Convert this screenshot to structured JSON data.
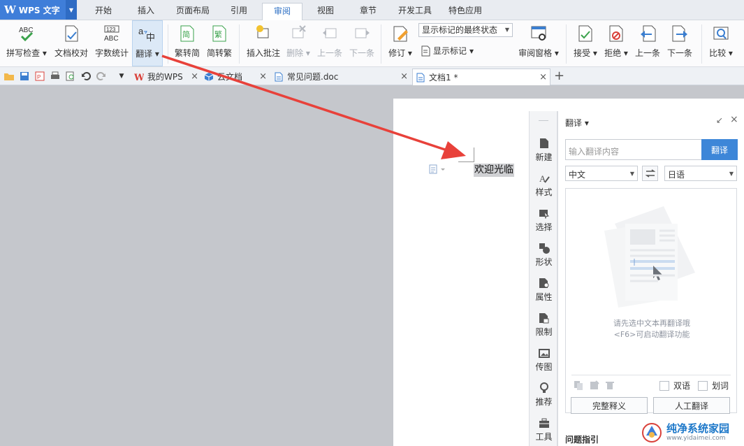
{
  "app": {
    "name": "WPS 文字"
  },
  "menu": {
    "tabs": [
      "开始",
      "插入",
      "页面布局",
      "引用",
      "审阅",
      "视图",
      "章节",
      "开发工具",
      "特色应用"
    ],
    "active_index": 4
  },
  "ribbon": {
    "spell_check": "拼写检查",
    "doc_proof": "文档校对",
    "word_count": "字数统计",
    "translate": "翻译",
    "trad_to_simp": "繁转简",
    "simp_to_trad": "简转繁",
    "insert_comment": "插入批注",
    "delete": "删除",
    "prev_comment": "上一条",
    "next_comment": "下一条",
    "track_changes": "修订",
    "markup_status": "显示标记的最终状态",
    "show_markup": "显示标记",
    "review_pane": "审阅窗格",
    "accept": "接受",
    "reject": "拒绝",
    "prev_change": "上一条",
    "next_change": "下一条",
    "compare": "比较"
  },
  "doc_tabs": [
    {
      "label": "我的WPS"
    },
    {
      "label": "云文档"
    },
    {
      "label": "常见问题.doc"
    },
    {
      "label": "文档1 *"
    }
  ],
  "document": {
    "text": "欢迎光临"
  },
  "sidebar": {
    "items": [
      "新建",
      "样式",
      "选择",
      "形状",
      "属性",
      "限制",
      "传图",
      "推荐",
      "工具"
    ]
  },
  "translate_panel": {
    "title": "翻译",
    "input_placeholder": "输入翻译内容",
    "translate_button": "翻译",
    "source_lang": "中文",
    "target_lang": "日语",
    "hint_line1": "请先选中文本再翻译哦",
    "hint_line2": "<F6>可启动翻译功能",
    "bilingual_label": "双语",
    "word_select_label": "划词",
    "full_def_button": "完整释义",
    "human_translate_button": "人工翻译",
    "footer": "问题指引"
  },
  "watermark": {
    "title": "纯净系统家园",
    "url": "www.yidaimei.com"
  },
  "colors": {
    "accent": "#3d86d8",
    "arrow": "#e8413a",
    "app_blue": "#3f7ed9"
  }
}
